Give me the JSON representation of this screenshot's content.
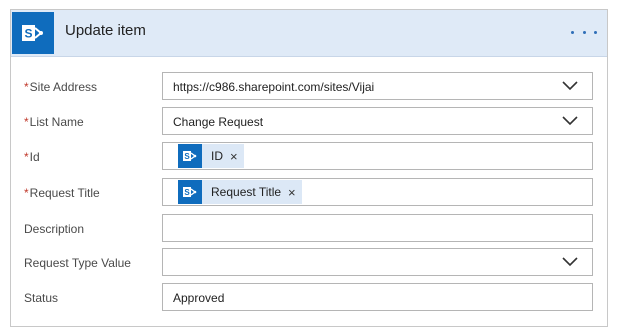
{
  "action": {
    "title": "Update item",
    "icon": "sharepoint-icon",
    "more_icon": "more-options-icon"
  },
  "fields": {
    "site_address": {
      "label": "Site Address",
      "required": "*",
      "value": "https://c986.sharepoint.com/sites/Vijai"
    },
    "list_name": {
      "label": "List Name",
      "required": "*",
      "value": "Change Request"
    },
    "id": {
      "label": "Id",
      "required": "*",
      "token": "ID",
      "remove": "×"
    },
    "request_title": {
      "label": "Request Title",
      "required": "*",
      "token": "Request Title",
      "remove": "×"
    },
    "description": {
      "label": "Description",
      "value": ""
    },
    "request_type_value": {
      "label": "Request Type Value",
      "value": ""
    },
    "status": {
      "label": "Status",
      "value": "Approved"
    }
  },
  "colors": {
    "header_bg": "#dfeaf7",
    "accent": "#0f6cbd",
    "required": "#c0392b",
    "token_bg": "#dce8f6"
  }
}
